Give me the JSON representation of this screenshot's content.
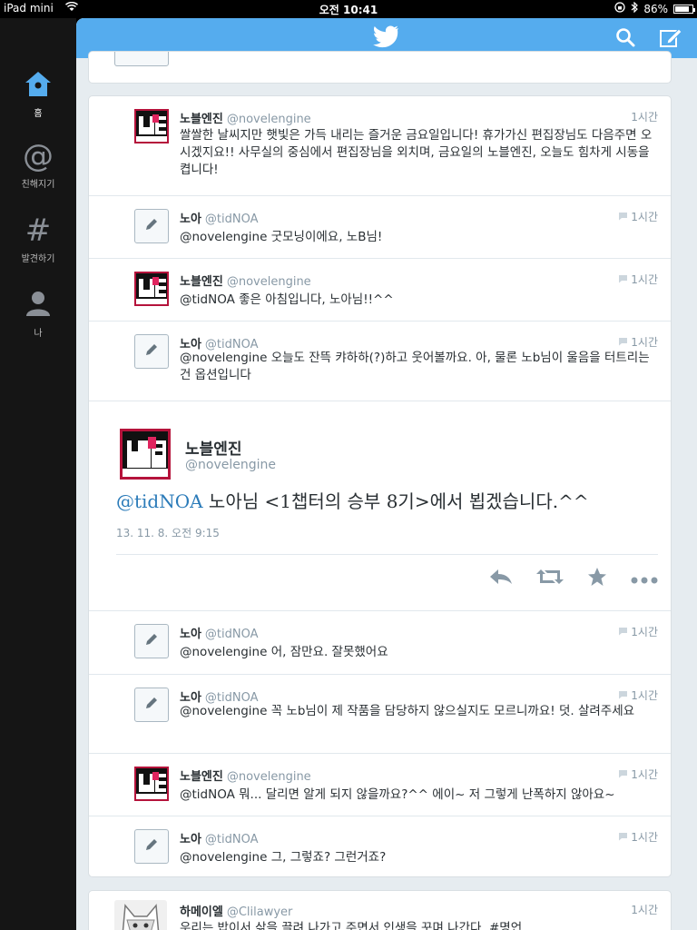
{
  "status_bar": {
    "carrier": "iPad mini",
    "time": "오전 10:41",
    "battery": "86%",
    "battery_level": 0.86
  },
  "sidebar": {
    "items": [
      {
        "label": "홈",
        "icon": "home-icon",
        "active": true
      },
      {
        "label": "친해지기",
        "icon": "at-icon",
        "active": false
      },
      {
        "label": "발견하기",
        "icon": "hash-icon",
        "active": false
      },
      {
        "label": "나",
        "icon": "person-icon",
        "active": false
      }
    ]
  },
  "topbar": {
    "logo": "bird-icon",
    "actions": [
      "search-icon",
      "compose-icon"
    ]
  },
  "conversation": [
    {
      "name": "노블엔진",
      "handle": "@novelengine",
      "time": "1시간",
      "text": "쌀쌀한 날씨지만 햇빛은 가득 내리는 즐거운 금요일입니다! 휴가가신 편집장님도 다음주면 오시겠지요!! 사무실의 중심에서 편집장님을 외치며, 금요일의 노블엔진, 오늘도 힘차게 시동을 켭니다!"
    },
    {
      "name": "노아",
      "handle": "@tidNOA",
      "time": "1시간",
      "text": "@novelengine 굿모닝이에요, 노B님!"
    },
    {
      "name": "노블엔진",
      "handle": "@novelengine",
      "time": "1시간",
      "text": "@tidNOA 좋은 아침입니다, 노아님!!^^"
    },
    {
      "name": "노아",
      "handle": "@tidNOA",
      "time": "1시간",
      "text": "@novelengine 오늘도 잔뜩 캬하하(?)하고 웃어볼까요. 아, 물론 노b님이 울음을 터트리는 건 옵션입니다"
    }
  ],
  "focused_tweet": {
    "name": "노블엔진",
    "handle": "@novelengine",
    "mention": "@tidNOA",
    "text": " 노아님 <1챕터의 승부 8기>에서 뵙겠습니다.^^",
    "timestamp": "13. 11. 8. 오전 9:15"
  },
  "replies": [
    {
      "name": "노아",
      "handle": "@tidNOA",
      "time": "1시간",
      "text": "@novelengine 어, 잠만요. 잘못했어요"
    },
    {
      "name": "노아",
      "handle": "@tidNOA",
      "time": "1시간",
      "text": "@novelengine 꼭 노b님이 제 작품을 담당하지 않으실지도 모르니까요! 덧. 살려주세요"
    },
    {
      "name": "노블엔진",
      "handle": "@novelengine",
      "time": "1시간",
      "text": "@tidNOA 뭐... 달리면 알게 되지 않을까요?^^ 에이~ 저 그렇게 난폭하지 않아요~"
    },
    {
      "name": "노아",
      "handle": "@tidNOA",
      "time": "1시간",
      "text": "@novelengine 그, 그렇죠? 그런거죠?"
    }
  ],
  "next_tweet": {
    "name": "하메이엘",
    "handle": "@Clilawyer",
    "time": "1시간",
    "text": "우리는 밥이서 삶을 끌려 나가고 주면서 인생을 꾸며 나간다. #명언"
  },
  "colors": {
    "brand": "#55acee",
    "link": "#2b7bb9",
    "muted": "#8899a6"
  }
}
